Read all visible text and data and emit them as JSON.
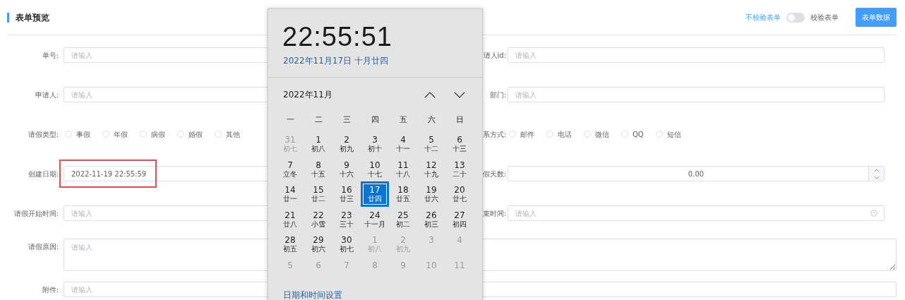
{
  "header": {
    "title": "表单预览",
    "switch": {
      "off_label": "不校验表单",
      "on_label": "校验表单",
      "on": false
    },
    "data_button": "表单数据"
  },
  "form": {
    "rows": [
      {
        "kind": "pair",
        "left": {
          "kind": "text",
          "label": "单号:",
          "placeholder": "请输入"
        },
        "right": {
          "kind": "text",
          "label": "请人id:",
          "placeholder": "请输入"
        }
      },
      {
        "kind": "pair",
        "left": {
          "kind": "text",
          "label": "申请人:",
          "placeholder": "请输入"
        },
        "right": {
          "kind": "text",
          "label": "部门:",
          "placeholder": "请输入"
        }
      },
      {
        "kind": "pair",
        "left": {
          "kind": "radio",
          "label": "请假类型:",
          "options": [
            {
              "label": "事假",
              "selected": false
            },
            {
              "label": "年假",
              "selected": false
            },
            {
              "label": "病假",
              "selected": false
            },
            {
              "label": "婚假",
              "selected": false
            },
            {
              "label": "其他",
              "selected": false
            }
          ]
        },
        "right": {
          "kind": "radio",
          "label": "系方式:",
          "options": [
            {
              "label": "邮件",
              "selected": false
            },
            {
              "label": "电话",
              "selected": false
            },
            {
              "label": "微信",
              "selected": false
            },
            {
              "label": "QQ",
              "selected": false
            },
            {
              "label": "短信",
              "selected": false
            }
          ]
        }
      },
      {
        "kind": "pair",
        "left": {
          "kind": "text",
          "label": "创建日期:",
          "value": "2022-11-19 22:55:59",
          "highlighted": true
        },
        "right": {
          "kind": "number",
          "label": "假天数:",
          "value": "0.00"
        }
      },
      {
        "kind": "pair",
        "left": {
          "kind": "text",
          "label": "请假开始时间:",
          "placeholder": "请输入"
        },
        "right": {
          "kind": "time",
          "label": "束时间:",
          "placeholder": "请输入"
        }
      },
      {
        "kind": "textarea",
        "label": "请假原因:",
        "placeholder": "请输入"
      },
      {
        "kind": "wide",
        "label": "附件:",
        "placeholder": "请输入"
      }
    ]
  },
  "clock_flyout": {
    "time": "22:55:51",
    "date": "2022年11月17日 十月廿四",
    "month": "2022年11月",
    "weekdays": [
      "一",
      "二",
      "三",
      "四",
      "五",
      "六",
      "日"
    ],
    "weeks": [
      [
        {
          "day": "31",
          "lunar": "初七",
          "in_month": false,
          "selected": false
        },
        {
          "day": "1",
          "lunar": "初八",
          "in_month": true,
          "selected": false
        },
        {
          "day": "2",
          "lunar": "初九",
          "in_month": true,
          "selected": false
        },
        {
          "day": "3",
          "lunar": "初十",
          "in_month": true,
          "selected": false
        },
        {
          "day": "4",
          "lunar": "十一",
          "in_month": true,
          "selected": false
        },
        {
          "day": "5",
          "lunar": "十二",
          "in_month": true,
          "selected": false
        },
        {
          "day": "6",
          "lunar": "十三",
          "in_month": true,
          "selected": false
        }
      ],
      [
        {
          "day": "7",
          "lunar": "立冬",
          "in_month": true,
          "selected": false
        },
        {
          "day": "8",
          "lunar": "十五",
          "in_month": true,
          "selected": false
        },
        {
          "day": "9",
          "lunar": "十六",
          "in_month": true,
          "selected": false
        },
        {
          "day": "10",
          "lunar": "十七",
          "in_month": true,
          "selected": false
        },
        {
          "day": "11",
          "lunar": "十八",
          "in_month": true,
          "selected": false
        },
        {
          "day": "12",
          "lunar": "十九",
          "in_month": true,
          "selected": false
        },
        {
          "day": "13",
          "lunar": "二十",
          "in_month": true,
          "selected": false
        }
      ],
      [
        {
          "day": "14",
          "lunar": "廿一",
          "in_month": true,
          "selected": false
        },
        {
          "day": "15",
          "lunar": "廿二",
          "in_month": true,
          "selected": false
        },
        {
          "day": "16",
          "lunar": "廿三",
          "in_month": true,
          "selected": false
        },
        {
          "day": "17",
          "lunar": "廿四",
          "in_month": true,
          "selected": true
        },
        {
          "day": "18",
          "lunar": "廿五",
          "in_month": true,
          "selected": false
        },
        {
          "day": "19",
          "lunar": "廿六",
          "in_month": true,
          "selected": false
        },
        {
          "day": "20",
          "lunar": "廿七",
          "in_month": true,
          "selected": false
        }
      ],
      [
        {
          "day": "21",
          "lunar": "廿八",
          "in_month": true,
          "selected": false
        },
        {
          "day": "22",
          "lunar": "小雪",
          "in_month": true,
          "selected": false
        },
        {
          "day": "23",
          "lunar": "三十",
          "in_month": true,
          "selected": false
        },
        {
          "day": "24",
          "lunar": "十一月",
          "in_month": true,
          "selected": false
        },
        {
          "day": "25",
          "lunar": "初二",
          "in_month": true,
          "selected": false
        },
        {
          "day": "26",
          "lunar": "初三",
          "in_month": true,
          "selected": false
        },
        {
          "day": "27",
          "lunar": "初四",
          "in_month": true,
          "selected": false
        }
      ],
      [
        {
          "day": "28",
          "lunar": "初五",
          "in_month": true,
          "selected": false
        },
        {
          "day": "29",
          "lunar": "初六",
          "in_month": true,
          "selected": false
        },
        {
          "day": "30",
          "lunar": "初七",
          "in_month": true,
          "selected": false
        },
        {
          "day": "1",
          "lunar": "初八",
          "in_month": false,
          "selected": false
        },
        {
          "day": "2",
          "lunar": "初九",
          "in_month": false,
          "selected": false
        },
        {
          "day": "3",
          "in_month": false,
          "selected": false
        },
        {
          "day": "4",
          "in_month": false,
          "selected": false
        }
      ],
      [
        {
          "day": "5",
          "in_month": false,
          "selected": false
        },
        {
          "day": "6",
          "in_month": false,
          "selected": false
        },
        {
          "day": "7",
          "in_month": false,
          "selected": false
        },
        {
          "day": "8",
          "in_month": false,
          "selected": false
        },
        {
          "day": "9",
          "in_month": false,
          "selected": false
        },
        {
          "day": "10",
          "in_month": false,
          "selected": false
        },
        {
          "day": "11",
          "in_month": false,
          "selected": false
        }
      ]
    ],
    "settings_link": "日期和时间设置"
  }
}
